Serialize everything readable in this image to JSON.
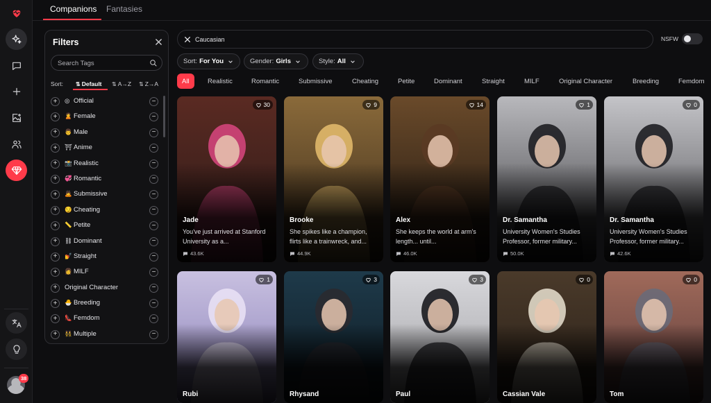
{
  "top_tabs": [
    {
      "label": "Companions",
      "active": true
    },
    {
      "label": "Fantasies",
      "active": false
    }
  ],
  "rail": {
    "notification_count": "38",
    "icons": [
      "heartbeat-logo-icon",
      "sparkles-icon",
      "chat-bubble-icon",
      "plus-icon",
      "image-plus-icon",
      "users-icon",
      "gem-icon",
      "translate-icon",
      "lightbulb-icon"
    ]
  },
  "filters": {
    "title": "Filters",
    "search_placeholder": "Search Tags",
    "sort_label": "Sort:",
    "sort_options": [
      {
        "label": "Default",
        "active": true
      },
      {
        "label": "A→Z",
        "active": false
      },
      {
        "label": "Z→A",
        "active": false
      }
    ],
    "tags": [
      {
        "emoji": "◎",
        "label": "Official"
      },
      {
        "emoji": "🙎",
        "label": "Female"
      },
      {
        "emoji": "👨",
        "label": "Male"
      },
      {
        "emoji": "⛩",
        "label": "Anime"
      },
      {
        "emoji": "📸",
        "label": "Realistic"
      },
      {
        "emoji": "💞",
        "label": "Romantic"
      },
      {
        "emoji": "🙇",
        "label": "Submissive"
      },
      {
        "emoji": "😏",
        "label": "Cheating"
      },
      {
        "emoji": "📏",
        "label": "Petite"
      },
      {
        "emoji": "⛓",
        "label": "Dominant"
      },
      {
        "emoji": "💅",
        "label": "Straight"
      },
      {
        "emoji": "👩",
        "label": "MILF"
      },
      {
        "emoji": "",
        "label": "Original Character"
      },
      {
        "emoji": "🐣",
        "label": "Breeding"
      },
      {
        "emoji": "👠",
        "label": "Femdom"
      },
      {
        "emoji": "👯",
        "label": "Multiple"
      }
    ]
  },
  "search": {
    "value": "Caucasian"
  },
  "nsfw": {
    "label": "NSFW",
    "enabled": false
  },
  "dropdowns": [
    {
      "label": "Sort:",
      "value": "For You"
    },
    {
      "label": "Gender:",
      "value": "Girls"
    },
    {
      "label": "Style:",
      "value": "All"
    }
  ],
  "chips": [
    {
      "label": "All",
      "active": true
    },
    {
      "label": "Realistic"
    },
    {
      "label": "Romantic"
    },
    {
      "label": "Submissive"
    },
    {
      "label": "Cheating"
    },
    {
      "label": "Petite"
    },
    {
      "label": "Dominant"
    },
    {
      "label": "Straight"
    },
    {
      "label": "MILF"
    },
    {
      "label": "Original Character"
    },
    {
      "label": "Breeding"
    },
    {
      "label": "Femdom"
    }
  ],
  "cards": [
    {
      "name": "Jade",
      "likes": "30",
      "desc": "You've just arrived at Stanford University as a...",
      "chats": "43.6K",
      "palette": [
        "#5a2a22",
        "#2a1a18",
        "#d2457a"
      ]
    },
    {
      "name": "Brooke",
      "likes": "9",
      "desc": "She spikes like a champion, flirts like a trainwreck, and...",
      "chats": "44.9K",
      "palette": [
        "#8a6a3a",
        "#3a2a1a",
        "#e0b86a"
      ]
    },
    {
      "name": "Alex",
      "likes": "14",
      "desc": "She keeps the world at arm's length... until...",
      "chats": "46.0K",
      "palette": [
        "#6a4a2a",
        "#1e1610",
        "#5a3a24"
      ]
    },
    {
      "name": "Dr. Samantha",
      "likes": "1",
      "desc": "University Women's Studies Professor, former military...",
      "chats": "50.0K",
      "palette": [
        "#b8b8bc",
        "#3a3a3e",
        "#1e1e22"
      ]
    },
    {
      "name": "Dr. Samantha",
      "likes": "0",
      "desc": "University Women's Studies Professor, former military...",
      "chats": "42.6K",
      "palette": [
        "#c4c4c8",
        "#4a4a4e",
        "#1e1e22"
      ]
    },
    {
      "name": "Rubi",
      "likes": "1",
      "desc": "",
      "chats": "",
      "palette": [
        "#c8c0e0",
        "#8a80b8",
        "#e8e0f4"
      ]
    },
    {
      "name": "Rhysand",
      "likes": "3",
      "desc": "",
      "chats": "",
      "palette": [
        "#1e3a4a",
        "#0e1a22",
        "#2a2a30"
      ]
    },
    {
      "name": "Paul",
      "likes": "3",
      "desc": "",
      "chats": "",
      "palette": [
        "#d8d8dc",
        "#a0a0a4",
        "#1a1a1e"
      ]
    },
    {
      "name": "Cassian Vale",
      "likes": "0",
      "desc": "",
      "chats": "",
      "palette": [
        "#4a3a2a",
        "#2a2018",
        "#e0d8c8"
      ]
    },
    {
      "name": "Tom",
      "likes": "0",
      "desc": "",
      "chats": "",
      "palette": [
        "#a06a5a",
        "#5a3a3a",
        "#6a6a78"
      ]
    }
  ],
  "colors": {
    "accent": "#ff3b4a",
    "background": "#0e0e10",
    "panel": "#121214"
  }
}
